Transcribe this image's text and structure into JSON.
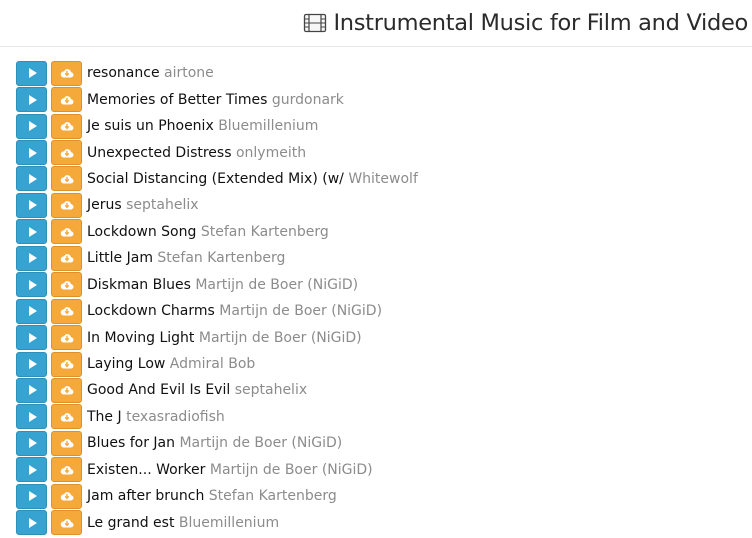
{
  "header": {
    "title": "Instrumental Music for Film and Video",
    "icon": "film-icon"
  },
  "colors": {
    "play_button": "#37a3d1",
    "download_button": "#f4a93a",
    "track_name": "#111111",
    "artist": "#8c8c8c"
  },
  "buttons": {
    "play_icon": "play-icon",
    "download_icon": "cloud-download-icon"
  },
  "tracks": [
    {
      "name": "resonance",
      "artist": "airtone"
    },
    {
      "name": "Memories of Better Times",
      "artist": "gurdonark"
    },
    {
      "name": "Je suis un Phoenix",
      "artist": "Bluemillenium"
    },
    {
      "name": "Unexpected Distress",
      "artist": "onlymeith"
    },
    {
      "name": "Social Distancing (Extended Mix) (w/",
      "artist": "Whitewolf"
    },
    {
      "name": "Jerus",
      "artist": "septahelix"
    },
    {
      "name": "Lockdown Song",
      "artist": "Stefan Kartenberg"
    },
    {
      "name": "Little Jam",
      "artist": "Stefan Kartenberg"
    },
    {
      "name": "Diskman Blues",
      "artist": "Martijn de Boer (NiGiD)"
    },
    {
      "name": "Lockdown Charms",
      "artist": "Martijn de Boer (NiGiD)"
    },
    {
      "name": "In Moving Light",
      "artist": "Martijn de Boer (NiGiD)"
    },
    {
      "name": "Laying Low",
      "artist": "Admiral Bob"
    },
    {
      "name": "Good And Evil Is Evil",
      "artist": "septahelix"
    },
    {
      "name": "The J",
      "artist": "texasradiofish"
    },
    {
      "name": "Blues for Jan",
      "artist": "Martijn de Boer (NiGiD)"
    },
    {
      "name": "Existen... Worker",
      "artist": "Martijn de Boer (NiGiD)"
    },
    {
      "name": "Jam after brunch",
      "artist": "Stefan Kartenberg"
    },
    {
      "name": "Le grand est",
      "artist": "Bluemillenium"
    }
  ]
}
